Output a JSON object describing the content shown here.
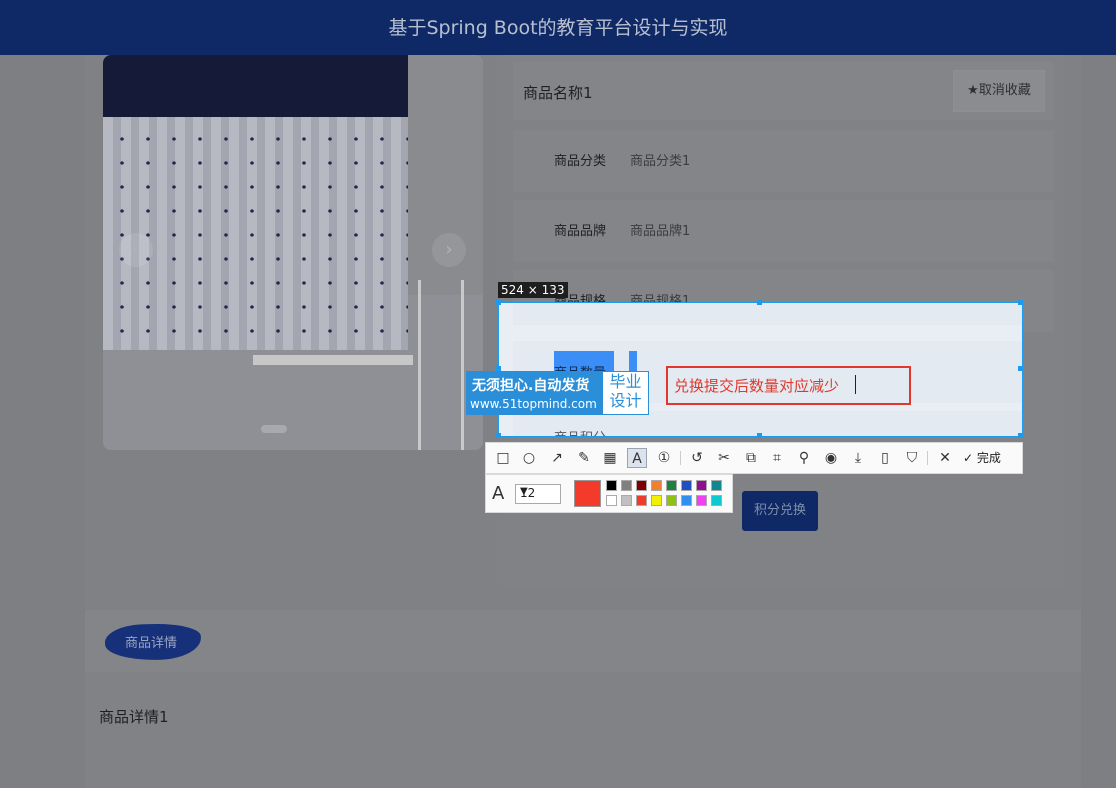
{
  "header": {
    "title": "基于Spring Boot的教育平台设计与实现"
  },
  "product": {
    "name": "商品名称1",
    "favorite_button": "★取消收藏",
    "fields": [
      {
        "label": "商品分类",
        "value": "商品分类1"
      },
      {
        "label": "商品品牌",
        "value": "商品品牌1"
      },
      {
        "label": "商品规格",
        "value": "商品规格1"
      },
      {
        "label": "商品数量",
        "value": ""
      },
      {
        "label": "商品积分",
        "value": ""
      }
    ],
    "redeem_button": "积分兑换"
  },
  "carousel": {
    "prev_glyph": "‹",
    "next_glyph": "›"
  },
  "screenshot_tool": {
    "size_label": "524 × 133",
    "annotation_text": "兑换提交后数量对应减少",
    "done_label": "完成",
    "font_size": "12",
    "current_color": "#f43a2a",
    "palette": [
      "#000000",
      "#808080",
      "#800000",
      "#f08030",
      "#208040",
      "#2050c0",
      "#901090",
      "#108890",
      "#ffffff",
      "#c0c0c0",
      "#f03a2a",
      "#f0f000",
      "#90c010",
      "#3090f0",
      "#f040f0",
      "#10c8d0"
    ],
    "tools": [
      "rectangle-icon",
      "circle-icon",
      "arrow-icon",
      "pencil-icon",
      "mosaic-icon",
      "text-icon",
      "number-icon",
      "undo-icon",
      "cut-icon",
      "translate-icon",
      "ocr-icon",
      "pin-icon",
      "record-icon",
      "download-icon",
      "phone-icon",
      "bookmark-icon",
      "close-icon",
      "check-icon"
    ]
  },
  "watermark": {
    "line1": "无须担心.自动发货",
    "line2": "www.51topmind.com",
    "badge": "毕业设计"
  },
  "details": {
    "tab": "商品详情",
    "content": "商品详情1"
  }
}
